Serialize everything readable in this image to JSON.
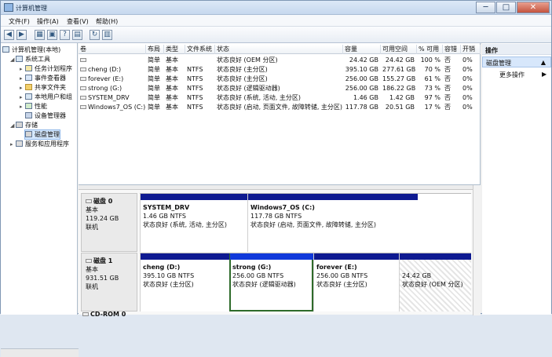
{
  "window": {
    "title": "计算机管理",
    "controls": [
      "─",
      "□",
      "✕"
    ]
  },
  "menu": {
    "items": [
      "文件(F)",
      "操作(A)",
      "查看(V)",
      "帮助(H)"
    ]
  },
  "toolbar": {
    "buttons": [
      "◀",
      "▶",
      "▦",
      "▣",
      "?",
      "▤",
      "↻",
      "▥"
    ]
  },
  "tree": {
    "root": "计算机管理(本地)",
    "system_tools": "系统工具",
    "task_scheduler": "任务计划程序",
    "event_viewer": "事件查看器",
    "shared_folders": "共享文件夹",
    "local_users": "本地用户和组",
    "performance": "性能",
    "device_manager": "设备管理器",
    "storage": "存储",
    "disk_management": "磁盘管理",
    "services": "服务和应用程序"
  },
  "list": {
    "headers": [
      "卷",
      "布局",
      "类型",
      "文件系统",
      "状态",
      "容量",
      "可用空间",
      "% 可用",
      "容错",
      "开销"
    ],
    "rows": [
      [
        "",
        "简单",
        "基本",
        "",
        "状态良好 (OEM 分区)",
        "24.42 GB",
        "24.42 GB",
        "100 %",
        "否",
        "0%"
      ],
      [
        "cheng (D:)",
        "简单",
        "基本",
        "NTFS",
        "状态良好 (主分区)",
        "395.10 GB",
        "277.61 GB",
        "70 %",
        "否",
        "0%"
      ],
      [
        "forever (E:)",
        "简单",
        "基本",
        "NTFS",
        "状态良好 (主分区)",
        "256.00 GB",
        "155.27 GB",
        "61 %",
        "否",
        "0%"
      ],
      [
        "strong (G:)",
        "简单",
        "基本",
        "NTFS",
        "状态良好 (逻辑驱动器)",
        "256.00 GB",
        "186.22 GB",
        "73 %",
        "否",
        "0%"
      ],
      [
        "SYSTEM_DRV",
        "简单",
        "基本",
        "NTFS",
        "状态良好 (系统, 活动, 主分区)",
        "1.46 GB",
        "1.42 GB",
        "97 %",
        "否",
        "0%"
      ],
      [
        "Windows7_OS (C:)",
        "简单",
        "基本",
        "NTFS",
        "状态良好 (启动, 页面文件, 故障转储, 主分区)",
        "117.78 GB",
        "20.51 GB",
        "17 %",
        "否",
        "0%"
      ]
    ]
  },
  "actions": {
    "header": "操作",
    "selected": "磁盘管理",
    "more": "更多操作"
  },
  "disks": [
    {
      "title": "磁盘 0",
      "type": "基本",
      "size": "119.24 GB",
      "state": "联机",
      "parts": [
        {
          "name": "SYSTEM_DRV",
          "size": "1.46 GB NTFS",
          "status": "状态良好 (系统, 活动, 主分区)"
        },
        {
          "name": "Windows7_OS (C:)",
          "size": "117.78 GB NTFS",
          "status": "状态良好 (启动, 页面文件, 故障转储, 主分区)"
        }
      ]
    },
    {
      "title": "磁盘 1",
      "type": "基本",
      "size": "931.51 GB",
      "state": "联机",
      "parts": [
        {
          "name": "cheng (D:)",
          "size": "395.10 GB NTFS",
          "status": "状态良好 (主分区)"
        },
        {
          "name": "strong (G:)",
          "size": "256.00 GB NTFS",
          "status": "状态良好 (逻辑驱动器)"
        },
        {
          "name": "forever (E:)",
          "size": "256.00 GB NTFS",
          "status": "状态良好 (主分区)"
        },
        {
          "name": "",
          "size": "24.42 GB",
          "status": "状态良好 (OEM 分区)"
        }
      ]
    }
  ],
  "cdrom": "CD-ROM 0"
}
